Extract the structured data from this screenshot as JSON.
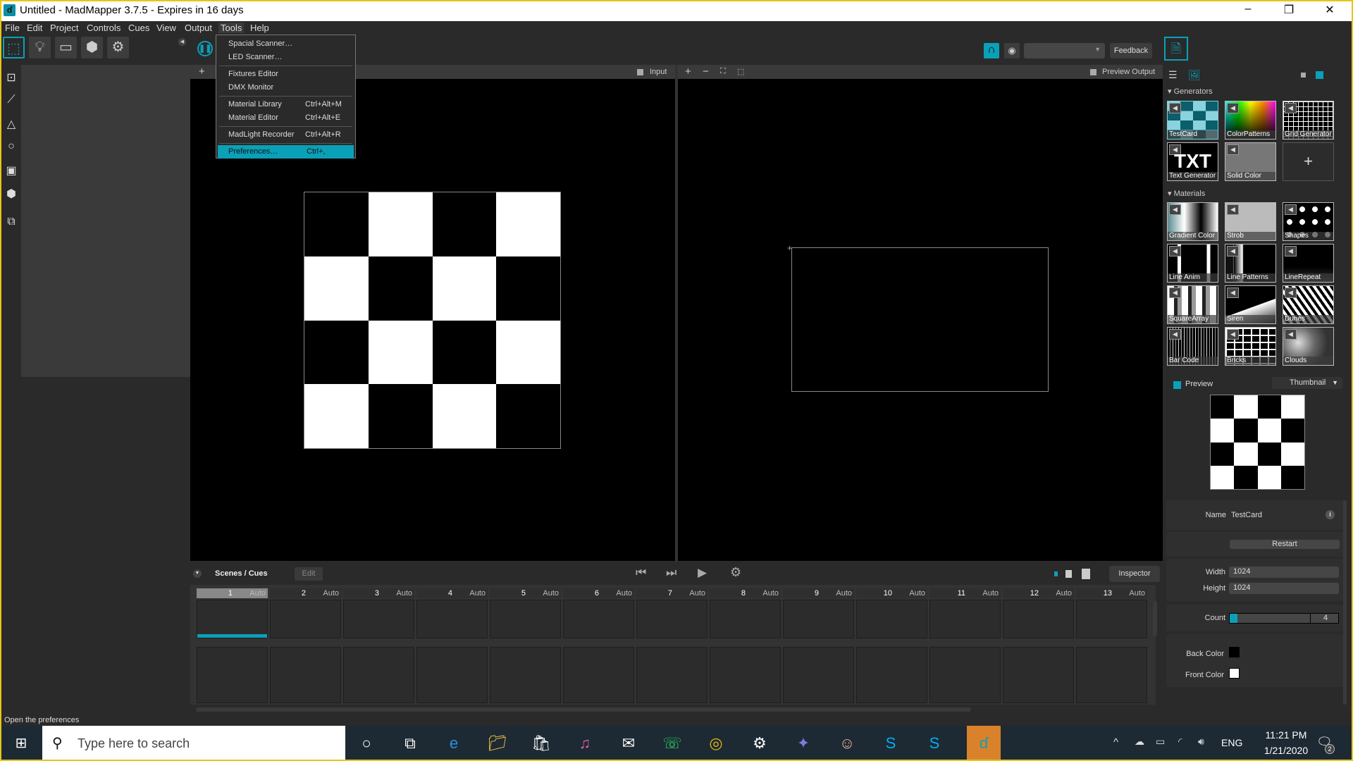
{
  "window": {
    "title": "Untitled - MadMapper 3.7.5 - Expires in 16 days",
    "accent": "#0aa0b8",
    "border": "#e6c619"
  },
  "menubar": [
    "File",
    "Edit",
    "Project",
    "Controls",
    "Cues",
    "View",
    "Output",
    "Tools",
    "Help"
  ],
  "tools_menu": {
    "items": [
      {
        "label": "Spacial Scanner…",
        "shortcut": ""
      },
      {
        "label": "LED Scanner…",
        "shortcut": ""
      },
      {
        "sep": true
      },
      {
        "label": "Fixtures Editor",
        "shortcut": ""
      },
      {
        "label": "DMX Monitor",
        "shortcut": ""
      },
      {
        "sep": true
      },
      {
        "label": "Material Library",
        "shortcut": "Ctrl+Alt+M"
      },
      {
        "label": "Material Editor",
        "shortcut": "Ctrl+Alt+E"
      },
      {
        "sep": true
      },
      {
        "label": "MadLight Recorder",
        "shortcut": "Ctrl+Alt+R"
      },
      {
        "sep": true
      },
      {
        "label": "Preferences…",
        "shortcut": "Ctrl+,",
        "highlighted": true
      }
    ]
  },
  "toolbar": {
    "feedback": "Feedback",
    "output_select": ""
  },
  "viewports": {
    "input_label": "Input",
    "output_label": "Preview Output"
  },
  "library": {
    "generators_title": "Generators",
    "generators": [
      "TestCard",
      "ColorPatterns",
      "Grid Generator",
      "Text Generator",
      "Solid Color"
    ],
    "materials_title": "Materials",
    "materials": [
      "Gradient Color",
      "Strob",
      "Shapes",
      "Line Anim",
      "Line Patterns",
      "LineRepeat",
      "SquareArray",
      "Siren",
      "Dunes",
      "Bar Code",
      "Bricks",
      "Clouds"
    ],
    "txt_thumb": "TXT",
    "add": "+"
  },
  "inspector": {
    "preview_label": "Preview",
    "preview_mode": "Thumbnail",
    "name_label": "Name",
    "name_value": "TestCard",
    "restart": "Restart",
    "width_label": "Width",
    "width_value": "1024",
    "height_label": "Height",
    "height_value": "1024",
    "count_label": "Count",
    "count_value": "4",
    "count_fraction": 0.07,
    "back_color_label": "Back Color",
    "back_color": "#000000",
    "front_color_label": "Front Color",
    "front_color": "#ffffff"
  },
  "scenes": {
    "title": "Scenes / Cues",
    "edit": "Edit",
    "inspector": "Inspector",
    "cues": [
      {
        "n": "1",
        "mode": "Auto",
        "active": true
      },
      {
        "n": "2",
        "mode": "Auto"
      },
      {
        "n": "3",
        "mode": "Auto"
      },
      {
        "n": "4",
        "mode": "Auto"
      },
      {
        "n": "5",
        "mode": "Auto"
      },
      {
        "n": "6",
        "mode": "Auto"
      },
      {
        "n": "7",
        "mode": "Auto"
      },
      {
        "n": "8",
        "mode": "Auto"
      },
      {
        "n": "9",
        "mode": "Auto"
      },
      {
        "n": "10",
        "mode": "Auto"
      },
      {
        "n": "11",
        "mode": "Auto"
      },
      {
        "n": "12",
        "mode": "Auto"
      },
      {
        "n": "13",
        "mode": "Auto"
      }
    ]
  },
  "status": "Open the preferences",
  "taskbar": {
    "search_placeholder": "Type here to search",
    "time": "11:21 PM",
    "date": "1/21/2020",
    "lang": "ENG",
    "notifications": "2",
    "apps": [
      "cortana",
      "task-view",
      "edge",
      "file-explorer",
      "store",
      "itunes",
      "mail",
      "whatsapp",
      "chrome",
      "settings",
      "app-bird",
      "app-face",
      "skype",
      "skype-business",
      "madmapper"
    ]
  }
}
